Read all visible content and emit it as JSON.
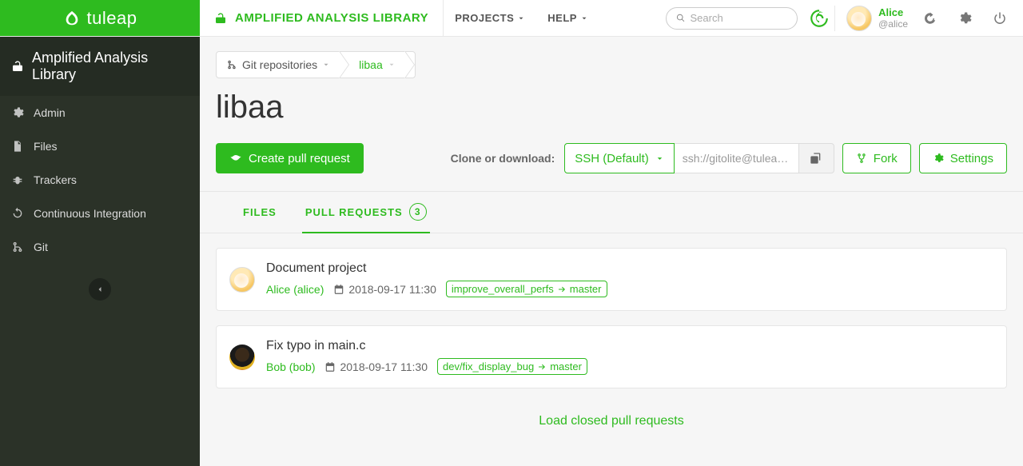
{
  "logo": "tuleap",
  "topbar": {
    "project_label": "AMPLIFIED ANALYSIS LIBRARY",
    "nav": {
      "projects": "PROJECTS",
      "help": "HELP"
    },
    "search_placeholder": "Search",
    "user": {
      "name": "Alice",
      "handle": "@alice"
    }
  },
  "sidebar": {
    "title": "Amplified Analysis Library",
    "items": {
      "admin": "Admin",
      "files": "Files",
      "trackers": "Trackers",
      "ci": "Continuous Integration",
      "git": "Git"
    }
  },
  "breadcrumb": {
    "root": "Git repositories",
    "current": "libaa"
  },
  "page": {
    "title": "libaa",
    "create_pr": "Create pull request",
    "clone_label": "Clone or download:",
    "ssh_label": "SSH (Default)",
    "ssh_url": "ssh://gitolite@tulea…",
    "fork": "Fork",
    "settings": "Settings"
  },
  "tabs": {
    "files": "FILES",
    "pull_requests": "PULL REQUESTS",
    "pr_count": "3"
  },
  "pull_requests": [
    {
      "title": "Document project",
      "author": "Alice (alice)",
      "date": "2018-09-17 11:30",
      "source_branch": "improve_overall_perfs",
      "target_branch": "master",
      "avatar_type": "alice"
    },
    {
      "title": "Fix typo in main.c",
      "author": "Bob (bob)",
      "date": "2018-09-17 11:30",
      "source_branch": "dev/fix_display_bug",
      "target_branch": "master",
      "avatar_type": "bob"
    }
  ],
  "load_closed": "Load closed pull requests"
}
